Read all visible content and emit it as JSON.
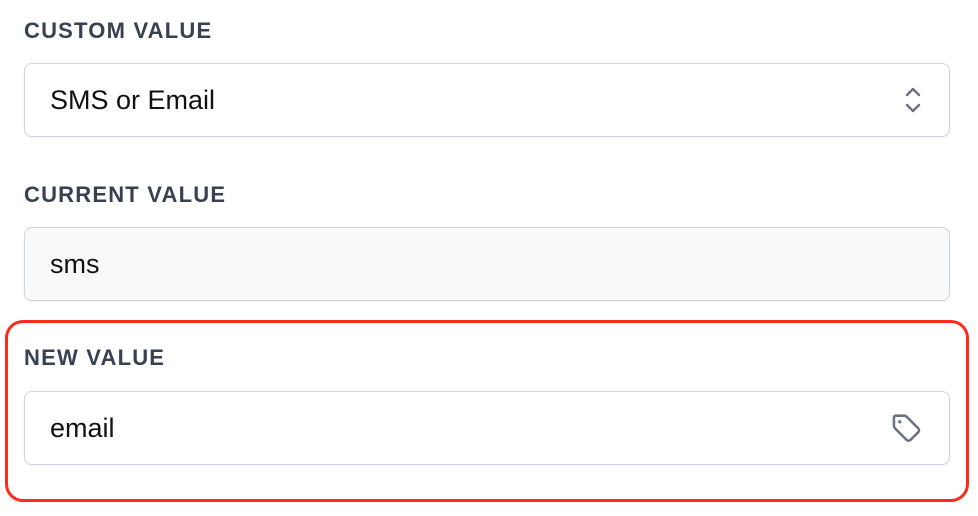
{
  "custom_value": {
    "label": "CUSTOM VALUE",
    "selected": "SMS or Email",
    "icon": "chevron-up-down-icon"
  },
  "current_value": {
    "label": "CURRENT VALUE",
    "value": "sms"
  },
  "new_value": {
    "label": "NEW VALUE",
    "value": "email",
    "icon": "tag-icon"
  },
  "highlight_color": "#ff2a1a"
}
